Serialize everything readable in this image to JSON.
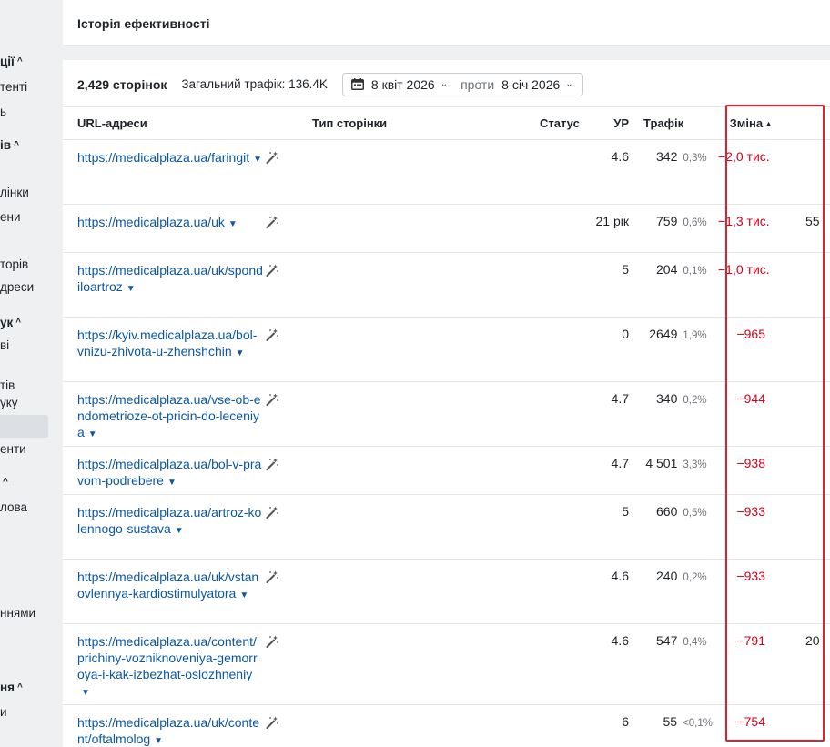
{
  "header": {
    "title": "Історія ефективності"
  },
  "summary": {
    "pages": "2,429 сторінок",
    "traffic": "Загальний трафік: 136.4K",
    "date_from": "8 квіт 2026",
    "vs": "проти",
    "date_to": "8 січ 2026"
  },
  "columns": {
    "url": "URL-адреси",
    "type": "Тип сторінки",
    "status": "Статус",
    "ur": "УР",
    "traffic": "Трафік",
    "change": "Зміна"
  },
  "rows": [
    {
      "url": "https://medicalplaza.ua/faringit",
      "ur": "4.6",
      "traffic": "342",
      "pct": "0,3%",
      "change": "−2,0 тис.",
      "extra": ""
    },
    {
      "url": "https://medicalplaza.ua/uk",
      "ur": "21 рік",
      "traffic": "759",
      "pct": "0,6%",
      "change": "−1,3 тис.",
      "extra": "55"
    },
    {
      "url": "https://medicalplaza.ua/uk/spondiloartroz",
      "ur": "5",
      "traffic": "204",
      "pct": "0,1%",
      "change": "−1,0 тис.",
      "extra": ""
    },
    {
      "url": "https://kyiv.medicalplaza.ua/bol-vnizu-zhivota-u-zhenshchin",
      "ur": "0",
      "traffic": "2649",
      "pct": "1,9%",
      "change": "−965",
      "extra": ""
    },
    {
      "url": "https://medicalplaza.ua/vse-ob-endometrioze-ot-pricin-do-leceniya",
      "ur": "4.7",
      "traffic": "340",
      "pct": "0,2%",
      "change": "−944",
      "extra": ""
    },
    {
      "url": "https://medicalplaza.ua/bol-v-pravom-podrebere",
      "ur": "4.7",
      "traffic": "4 501",
      "pct": "3,3%",
      "change": "−938",
      "extra": ""
    },
    {
      "url": "https://medicalplaza.ua/artroz-kolennogo-sustava",
      "ur": "5",
      "traffic": "660",
      "pct": "0,5%",
      "change": "−933",
      "extra": ""
    },
    {
      "url": "https://medicalplaza.ua/uk/vstanovlennya-kardiostimulyatora",
      "ur": "4.6",
      "traffic": "240",
      "pct": "0,2%",
      "change": "−933",
      "extra": ""
    },
    {
      "url": "https://medicalplaza.ua/content/prichiny-vozniknoveniya-gemorroya-i-kak-izbezhat-oslozhneniy",
      "ur": "4.6",
      "traffic": "547",
      "pct": "0,4%",
      "change": "−791",
      "extra": "20"
    },
    {
      "url": "https://medicalplaza.ua/uk/content/oftalmolog",
      "ur": "6",
      "traffic": "55",
      "pct": "<0,1%",
      "change": "−754",
      "extra": ""
    }
  ],
  "sidebar": [
    {
      "label": "ції",
      "bold": true,
      "caret": true
    },
    {
      "label": "тенті",
      "bold": false,
      "caret": false
    },
    {
      "label": "ь",
      "bold": false,
      "caret": false
    },
    {
      "label": "ів",
      "bold": true,
      "caret": true
    },
    {
      "label": "лінки",
      "bold": false,
      "caret": false
    },
    {
      "label": "ени",
      "bold": false,
      "caret": false
    },
    {
      "label": "торів",
      "bold": false,
      "caret": false
    },
    {
      "label": "дреси",
      "bold": false,
      "caret": false
    },
    {
      "label": "ук",
      "bold": true,
      "caret": true
    },
    {
      "label": "ві",
      "bold": false,
      "caret": false
    },
    {
      "label": "тів",
      "bold": false,
      "caret": false
    },
    {
      "label": "уку",
      "bold": false,
      "caret": false
    },
    {
      "label": "енти",
      "bold": false,
      "caret": false
    },
    {
      "label": "",
      "bold": true,
      "caret": true
    },
    {
      "label": "лова",
      "bold": false,
      "caret": false
    },
    {
      "label": "ннями",
      "bold": false,
      "caret": false
    },
    {
      "label": "ня",
      "bold": true,
      "caret": true
    },
    {
      "label": "и",
      "bold": false,
      "caret": false
    }
  ]
}
